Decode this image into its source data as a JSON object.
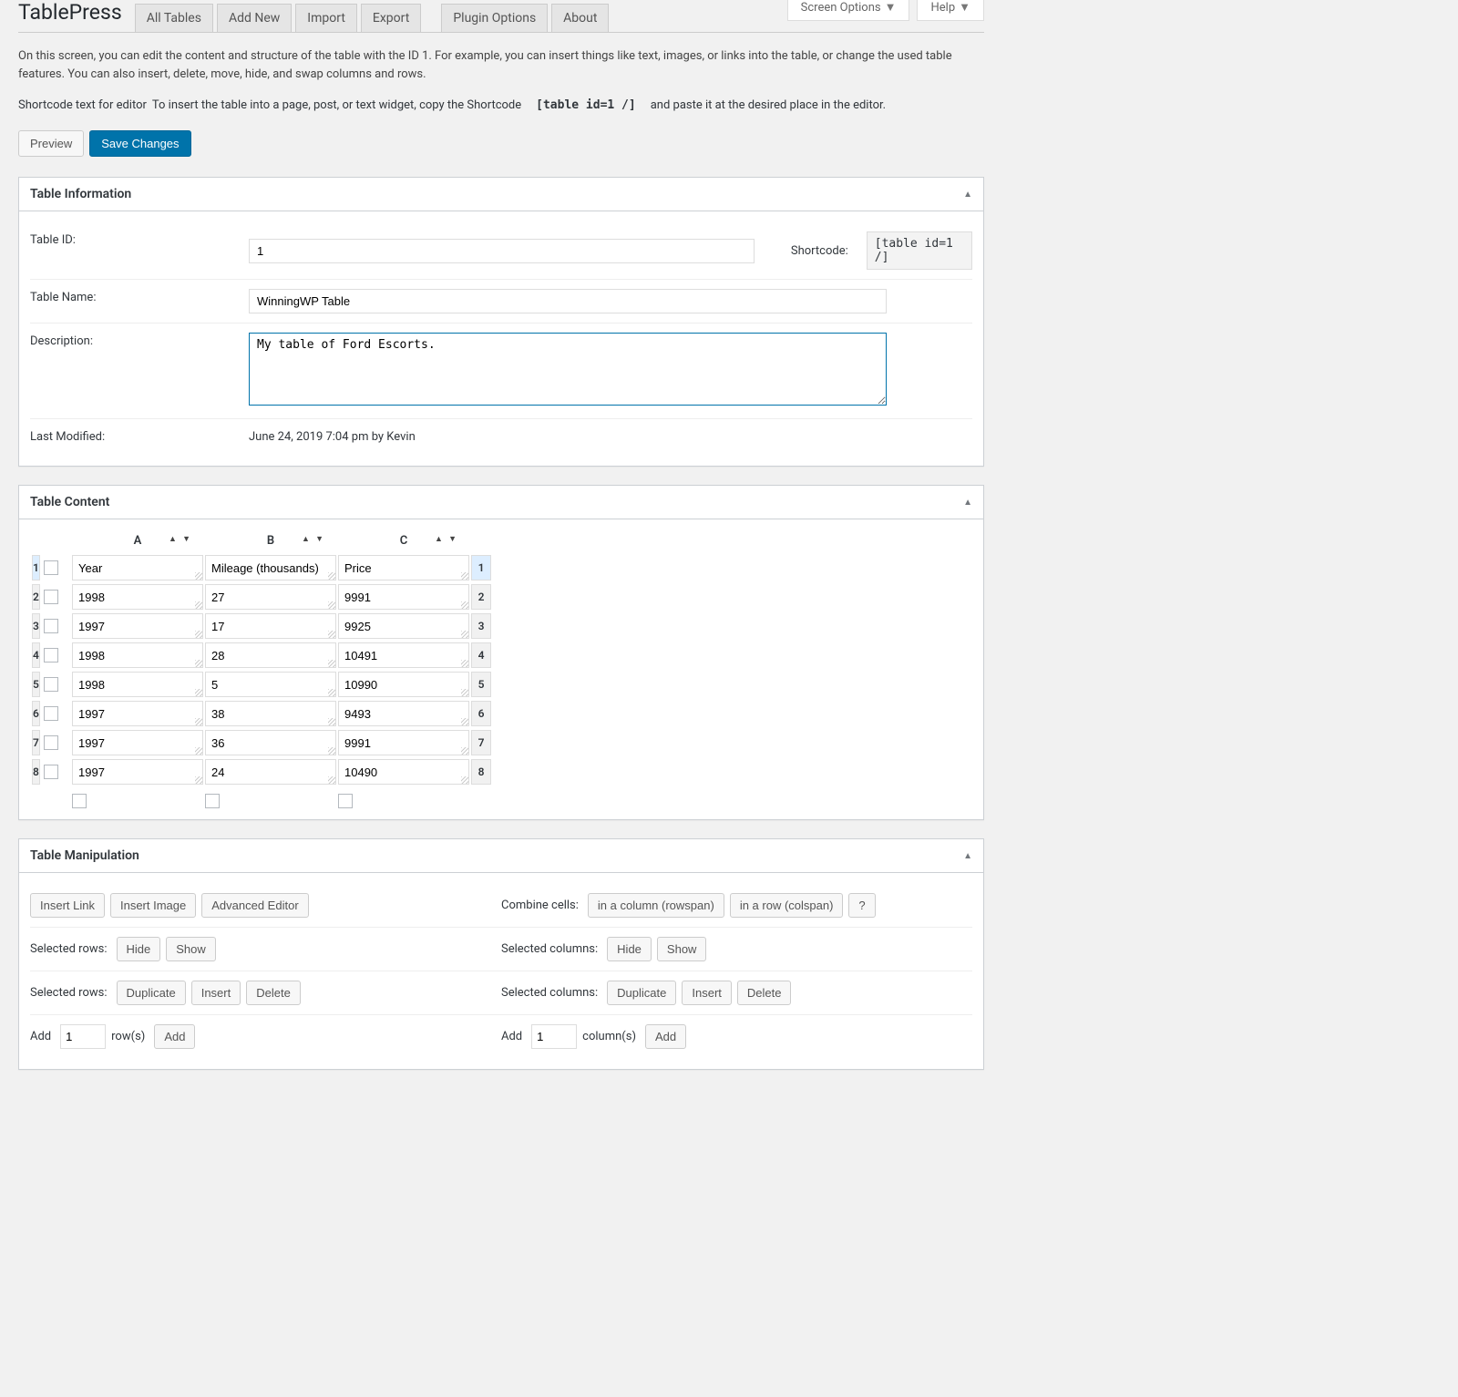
{
  "screen_meta": {
    "screen_options": "Screen Options",
    "help": "Help"
  },
  "page_title": "TablePress",
  "nav_tabs": [
    "All Tables",
    "Add New",
    "Import",
    "Export",
    "Plugin Options",
    "About"
  ],
  "intro_text": "On this screen, you can edit the content and structure of the table with the ID 1. For example, you can insert things like text, images, or links into the table, or change the used table features. You can also insert, delete, move, hide, and swap columns and rows.",
  "shortcode_line": {
    "label": "Shortcode text for editor",
    "before": "To insert the table into a page, post, or text widget, copy the Shortcode",
    "code": "[table id=1 /]",
    "after": "and paste it at the desired place in the editor."
  },
  "buttons": {
    "preview": "Preview",
    "save": "Save Changes"
  },
  "panel_info": {
    "title": "Table Information",
    "table_id_label": "Table ID:",
    "table_id_value": "1",
    "shortcode_label": "Shortcode:",
    "shortcode_value": "[table id=1 /]",
    "name_label": "Table Name:",
    "name_value": "WinningWP Table",
    "desc_label": "Description:",
    "desc_value": "My table of Ford Escorts.",
    "modified_label": "Last Modified:",
    "modified_value": "June 24, 2019 7:04 pm by Kevin"
  },
  "panel_content": {
    "title": "Table Content",
    "columns": [
      "A",
      "B",
      "C"
    ],
    "rows": [
      {
        "n": "1",
        "header": true,
        "cells": [
          "Year",
          "Mileage (thousands)",
          "Price"
        ]
      },
      {
        "n": "2",
        "cells": [
          "1998",
          "27",
          "9991"
        ]
      },
      {
        "n": "3",
        "cells": [
          "1997",
          "17",
          "9925"
        ]
      },
      {
        "n": "4",
        "cells": [
          "1998",
          "28",
          "10491"
        ]
      },
      {
        "n": "5",
        "cells": [
          "1998",
          "5",
          "10990"
        ]
      },
      {
        "n": "6",
        "cells": [
          "1997",
          "38",
          "9493"
        ]
      },
      {
        "n": "7",
        "cells": [
          "1997",
          "36",
          "9991"
        ]
      },
      {
        "n": "8",
        "cells": [
          "1997",
          "24",
          "10490"
        ]
      }
    ]
  },
  "panel_manip": {
    "title": "Table Manipulation",
    "insert_link": "Insert Link",
    "insert_image": "Insert Image",
    "adv_editor": "Advanced Editor",
    "combine_label": "Combine cells:",
    "rowspan": "in a column (rowspan)",
    "colspan": "in a row (colspan)",
    "qmark": "?",
    "sel_rows": "Selected rows:",
    "sel_cols": "Selected columns:",
    "hide": "Hide",
    "show": "Show",
    "duplicate": "Duplicate",
    "insert": "Insert",
    "delete": "Delete",
    "add": "Add",
    "add_rows_val": "1",
    "rows_label": "row(s)",
    "add_cols_val": "1",
    "cols_label": "column(s)"
  }
}
